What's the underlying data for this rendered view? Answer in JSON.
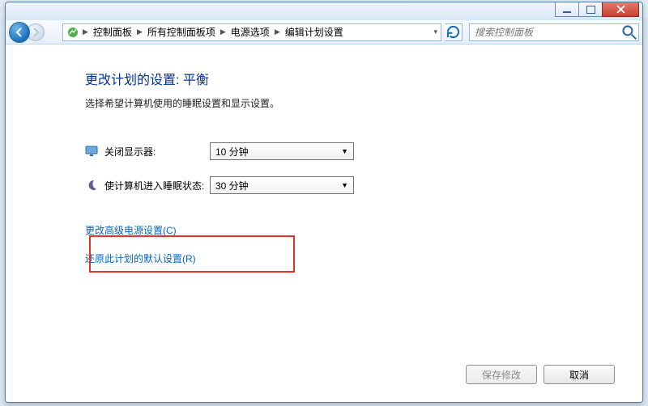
{
  "breadcrumb": {
    "items": [
      {
        "label": "控制面板"
      },
      {
        "label": "所有控制面板项"
      },
      {
        "label": "电源选项"
      },
      {
        "label": "编辑计划设置"
      }
    ]
  },
  "search": {
    "placeholder": "搜索控制面板"
  },
  "page": {
    "title": "更改计划的设置: 平衡",
    "subtitle": "选择希望计算机使用的睡眠设置和显示设置。"
  },
  "settings": {
    "display_off": {
      "label": "关闭显示器:",
      "value": "10 分钟"
    },
    "sleep": {
      "label": "使计算机进入睡眠状态:",
      "value": "30 分钟"
    }
  },
  "links": {
    "advanced": "更改高级电源设置(C)",
    "restore": "还原此计划的默认设置(R)"
  },
  "buttons": {
    "save": "保存修改",
    "cancel": "取消"
  }
}
